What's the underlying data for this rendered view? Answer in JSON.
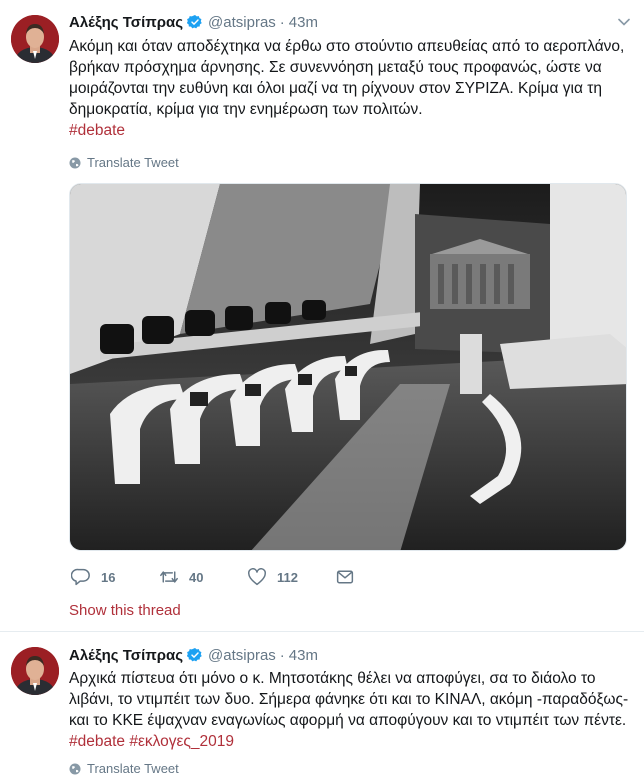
{
  "tweets": [
    {
      "author_name": "Αλέξης Τσίπρας",
      "handle": "@atsipras",
      "separator": "·",
      "time": "43m",
      "text": "Ακόμη και όταν αποδέχτηκα να έρθω στο στούντιο απευθείας από το αεροπλάνο, βρήκαν πρόσχημα άρνησης. Σε συνεννόηση μεταξύ τους προφανώς, ώστε να μοιράζονται την ευθύνη και όλοι μαζί να τη ρίχνουν στον ΣΥΡΙΖΑ. Κρίμα για τη δημοκρατία, κρίμα για την ενημέρωση των πολιτών.",
      "hashtag": "#debate",
      "translate_label": "Translate Tweet",
      "reply_count": "16",
      "retweet_count": "40",
      "like_count": "112",
      "show_thread": "Show this thread"
    },
    {
      "author_name": "Αλέξης Τσίπρας",
      "handle": "@atsipras",
      "separator": "·",
      "time": "43m",
      "text": "Αρχικά πίστευα ότι μόνο ο κ. Μητσοτάκης θέλει να αποφύγει, σα το διάολο το λιβάνι, το ντιμπέιτ των δυο. Σήμερα φάνηκε ότι και το ΚΙΝΑΛ, ακόμη -παραδόξως- και το ΚΚΕ έψαχναν εναγωνίως αφορμή να αποφύγουν και το ντιμπέιτ των πέντε.",
      "hashtag": "#debate",
      "hashtag2": "#εκλογες_2019",
      "translate_label": "Translate Tweet"
    }
  ],
  "colors": {
    "accent": "#b0303a",
    "verified": "#1da1f2",
    "muted": "#657786",
    "text": "#14171a"
  },
  "icons": [
    "verified-badge-icon",
    "chevron-down-icon",
    "globe-icon",
    "reply-icon",
    "retweet-icon",
    "like-icon",
    "direct-message-icon"
  ]
}
